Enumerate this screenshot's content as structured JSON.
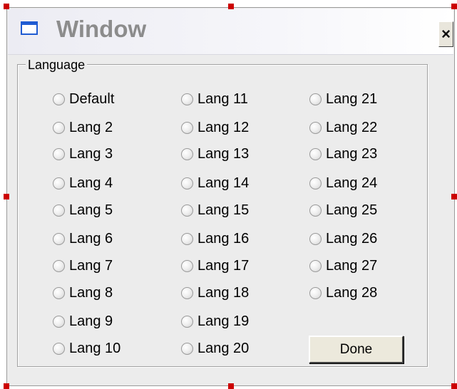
{
  "window": {
    "title": "Window",
    "close_label": "×"
  },
  "group": {
    "legend": "Language"
  },
  "radios": [
    "Default",
    "Lang 2",
    "Lang 3",
    "Lang 4",
    "Lang 5",
    "Lang 6",
    "Lang 7",
    "Lang 8",
    "Lang 9",
    "Lang 10",
    "Lang 11",
    "Lang 12",
    "Lang 13",
    "Lang 14",
    "Lang 15",
    "Lang 16",
    "Lang 17",
    "Lang 18",
    "Lang 19",
    "Lang 20",
    "Lang 21",
    "Lang 22",
    "Lang 23",
    "Lang 24",
    "Lang 25",
    "Lang 26",
    "Lang 27",
    "Lang 28"
  ],
  "done_label": "Done",
  "colors": {
    "handle": "#cc0000",
    "icon": "#1f5bd2",
    "title_text": "#8c8c8c"
  }
}
